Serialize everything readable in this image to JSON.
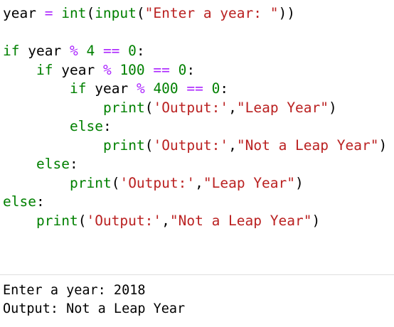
{
  "colors": {
    "default": "#000000",
    "keyword": "#008000",
    "operator": "#aa22ff",
    "number": "#008000",
    "string": "#ba2121",
    "builtin": "#008000"
  },
  "code_lines": [
    {
      "indent": 0,
      "tokens": [
        {
          "t": "year ",
          "k": "default"
        },
        {
          "t": "=",
          "k": "operator"
        },
        {
          "t": " ",
          "k": "default"
        },
        {
          "t": "int",
          "k": "builtin"
        },
        {
          "t": "(",
          "k": "default"
        },
        {
          "t": "input",
          "k": "builtin"
        },
        {
          "t": "(",
          "k": "default"
        },
        {
          "t": "\"Enter a year: \"",
          "k": "string"
        },
        {
          "t": "))",
          "k": "default"
        }
      ]
    },
    {
      "indent": 0,
      "tokens": []
    },
    {
      "indent": 0,
      "tokens": [
        {
          "t": "if",
          "k": "keyword"
        },
        {
          "t": " year ",
          "k": "default"
        },
        {
          "t": "%",
          "k": "operator"
        },
        {
          "t": " ",
          "k": "default"
        },
        {
          "t": "4",
          "k": "number"
        },
        {
          "t": " ",
          "k": "default"
        },
        {
          "t": "==",
          "k": "operator"
        },
        {
          "t": " ",
          "k": "default"
        },
        {
          "t": "0",
          "k": "number"
        },
        {
          "t": ":",
          "k": "default"
        }
      ]
    },
    {
      "indent": 1,
      "tokens": [
        {
          "t": "if",
          "k": "keyword"
        },
        {
          "t": " year ",
          "k": "default"
        },
        {
          "t": "%",
          "k": "operator"
        },
        {
          "t": " ",
          "k": "default"
        },
        {
          "t": "100",
          "k": "number"
        },
        {
          "t": " ",
          "k": "default"
        },
        {
          "t": "==",
          "k": "operator"
        },
        {
          "t": " ",
          "k": "default"
        },
        {
          "t": "0",
          "k": "number"
        },
        {
          "t": ":",
          "k": "default"
        }
      ]
    },
    {
      "indent": 2,
      "tokens": [
        {
          "t": "if",
          "k": "keyword"
        },
        {
          "t": " year ",
          "k": "default"
        },
        {
          "t": "%",
          "k": "operator"
        },
        {
          "t": " ",
          "k": "default"
        },
        {
          "t": "400",
          "k": "number"
        },
        {
          "t": " ",
          "k": "default"
        },
        {
          "t": "==",
          "k": "operator"
        },
        {
          "t": " ",
          "k": "default"
        },
        {
          "t": "0",
          "k": "number"
        },
        {
          "t": ":",
          "k": "default"
        }
      ]
    },
    {
      "indent": 3,
      "tokens": [
        {
          "t": "print",
          "k": "builtin"
        },
        {
          "t": "(",
          "k": "default"
        },
        {
          "t": "'Output:'",
          "k": "string"
        },
        {
          "t": ",",
          "k": "default"
        },
        {
          "t": "\"Leap Year\"",
          "k": "string"
        },
        {
          "t": ")",
          "k": "default"
        }
      ]
    },
    {
      "indent": 2,
      "tokens": [
        {
          "t": "else",
          "k": "keyword"
        },
        {
          "t": ":",
          "k": "default"
        }
      ]
    },
    {
      "indent": 3,
      "tokens": [
        {
          "t": "print",
          "k": "builtin"
        },
        {
          "t": "(",
          "k": "default"
        },
        {
          "t": "'Output:'",
          "k": "string"
        },
        {
          "t": ",",
          "k": "default"
        },
        {
          "t": "\"Not a Leap Year\"",
          "k": "string"
        },
        {
          "t": ")",
          "k": "default"
        }
      ]
    },
    {
      "indent": 1,
      "tokens": [
        {
          "t": "else",
          "k": "keyword"
        },
        {
          "t": ":",
          "k": "default"
        }
      ]
    },
    {
      "indent": 2,
      "tokens": [
        {
          "t": "print",
          "k": "builtin"
        },
        {
          "t": "(",
          "k": "default"
        },
        {
          "t": "'Output:'",
          "k": "string"
        },
        {
          "t": ",",
          "k": "default"
        },
        {
          "t": "\"Leap Year\"",
          "k": "string"
        },
        {
          "t": ")",
          "k": "default"
        }
      ]
    },
    {
      "indent": 0,
      "tokens": [
        {
          "t": "else",
          "k": "keyword"
        },
        {
          "t": ":",
          "k": "default"
        }
      ]
    },
    {
      "indent": 1,
      "tokens": [
        {
          "t": "print",
          "k": "builtin"
        },
        {
          "t": "(",
          "k": "default"
        },
        {
          "t": "'Output:'",
          "k": "string"
        },
        {
          "t": ",",
          "k": "default"
        },
        {
          "t": "\"Not a Leap Year\"",
          "k": "string"
        },
        {
          "t": ")",
          "k": "default"
        }
      ]
    }
  ],
  "output": {
    "lines": [
      "Enter a year: 2018",
      "Output: Not a Leap Year"
    ]
  }
}
